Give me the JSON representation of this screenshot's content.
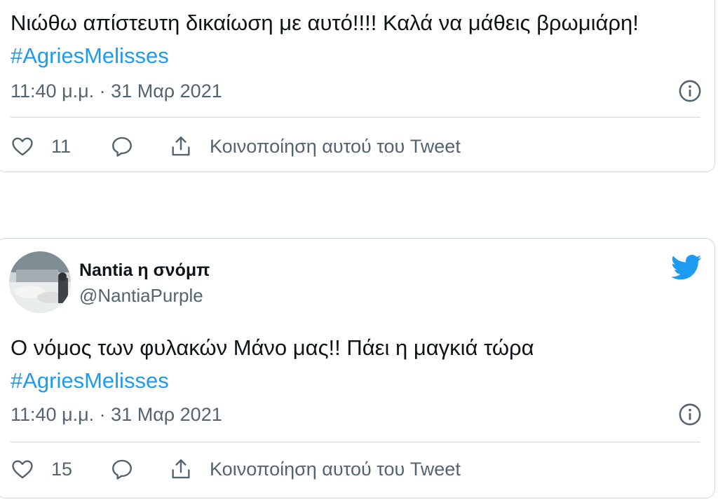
{
  "tweets": [
    {
      "text": "Νιώθω απίστευτη δικαίωση με αυτό!!!! Καλά να μάθεις βρωμιάρη! ",
      "hashtag": "#AgriesMelisses",
      "meta": "11:40 μ.μ. · 31 Μαρ 2021",
      "likes": "11",
      "share_label": "Κοινοποίηση αυτού του Tweet"
    },
    {
      "display_name": "Nantia η σνόμπ",
      "handle": "@NantiaPurple",
      "text": "Ο νόμος των φυλακών Μάνο μας!! Πάει η μαγκιά τώρα ",
      "hashtag": "#AgriesMelisses",
      "meta": "11:40 μ.μ. · 31 Μαρ 2021",
      "likes": "15",
      "share_label": "Κοινοποίηση αυτού του Tweet"
    }
  ],
  "colors": {
    "hashtag": "#1d9bf0",
    "twitter_blue": "#1d9bf0",
    "muted_text": "#536471",
    "border": "#cfd9de"
  },
  "icons": [
    "heart-icon",
    "reply-icon",
    "share-icon",
    "info-icon",
    "twitter-bird-icon"
  ]
}
